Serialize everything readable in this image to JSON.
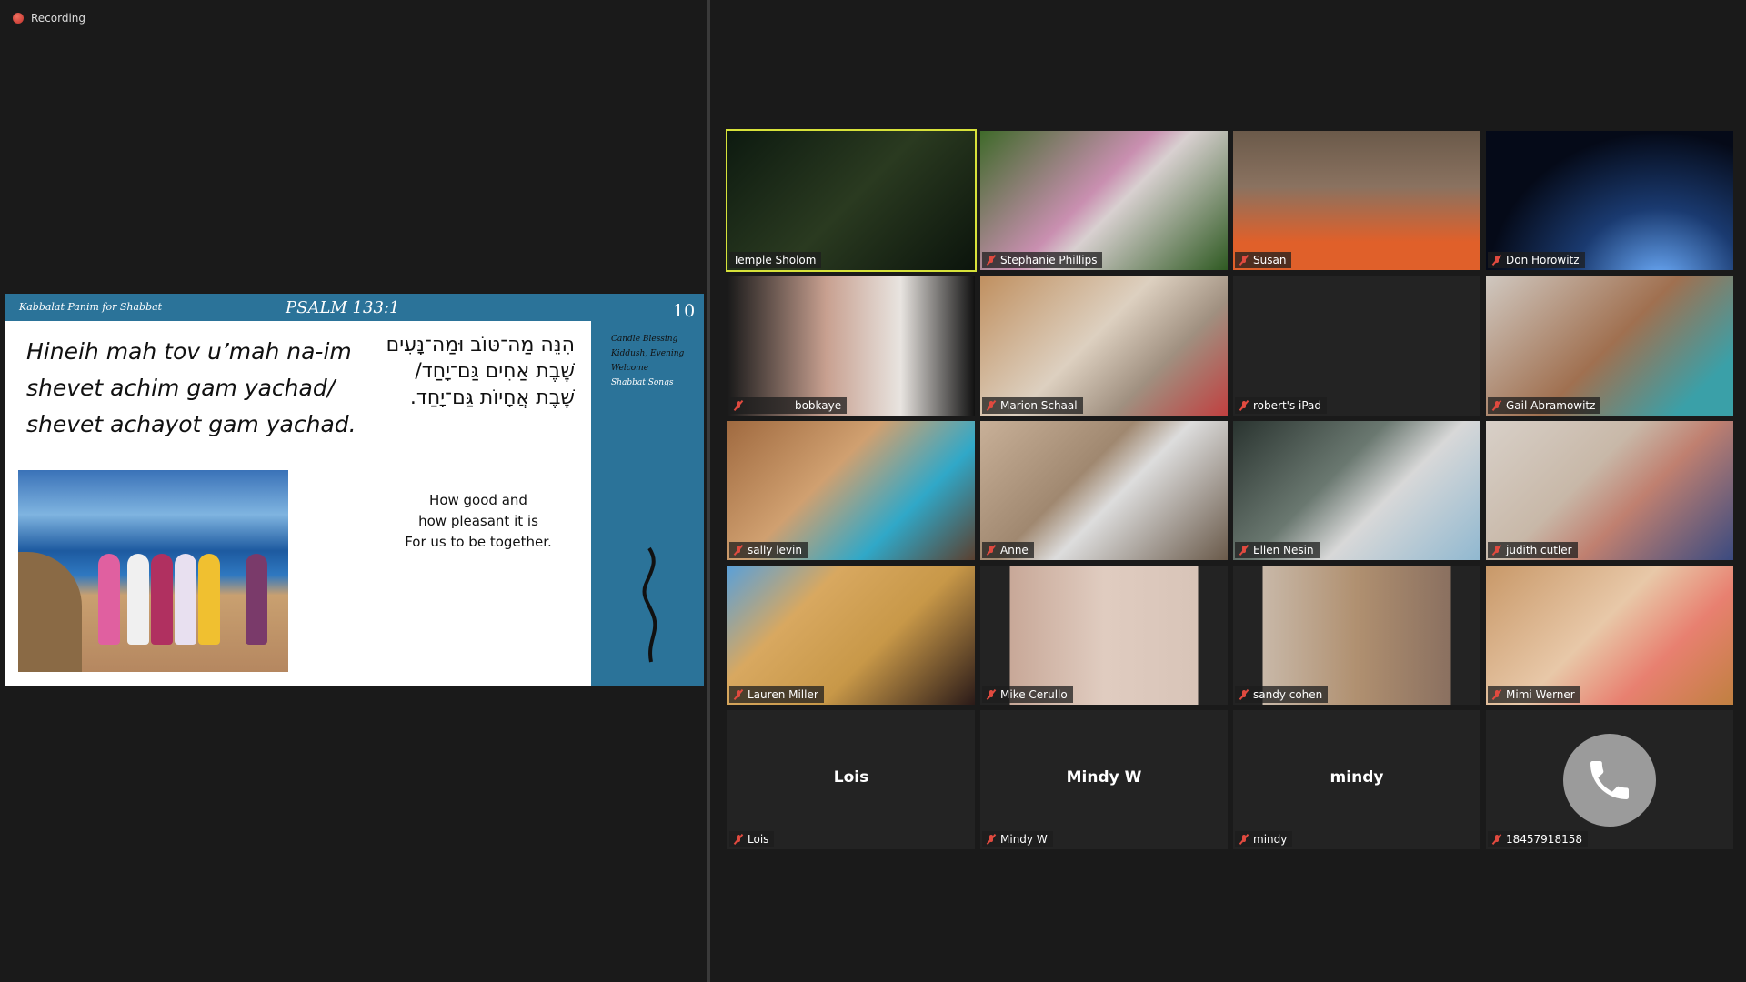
{
  "recording": {
    "label": "Recording",
    "color": "#d9443a"
  },
  "slide": {
    "header_left": "Kabbalat Panim for Shabbat",
    "title": "PSALM 133:1",
    "page_number": "10",
    "transliteration": [
      "Hineih mah tov u’mah na-im",
      "shevet achim gam yachad/",
      "shevet achayot gam yachad."
    ],
    "hebrew": [
      "הִנֵּה מַה־טּוֹב וּמַה־נָּעִים",
      "שֶׁבֶת אַחִים גַּם־יָחַד/",
      "שֶׁבֶת אֲחָיוֹת גַּם־יָחַד."
    ],
    "english": [
      "How good and",
      "how pleasant it is",
      "For us to be together."
    ],
    "nav": [
      "Candle Blessing",
      "Kiddush, Evening",
      "Welcome",
      "Shabbat Songs"
    ],
    "accent": "#2b7399"
  },
  "participants": [
    {
      "name": "Temple Sholom",
      "active": true,
      "muted": false,
      "bg": "linear-gradient(135deg,#0d1a10,#2a3a20 50%,#0b140c)"
    },
    {
      "name": "Stephanie Phillips",
      "muted": true,
      "bg": "linear-gradient(135deg,#3f6a2a,#c98fb0 45%,#d8d0d0 55%,#2f5a22)"
    },
    {
      "name": "Susan",
      "muted": true,
      "bg": "linear-gradient(180deg,#6b5a4a,#8a7260 40%,#e0602a 80%)"
    },
    {
      "name": "Don Horowitz",
      "muted": true,
      "bg": "radial-gradient(ellipse at 70% 110%,#6fb0ff 0%,#1a3a70 35%,#050a18 70%)"
    },
    {
      "name": "------------bobkaye",
      "muted": true,
      "bg": "linear-gradient(90deg,#1a1a1a,#c8a090 40%,#e8e4e0 70%,#111)"
    },
    {
      "name": "Marion Schaal",
      "muted": true,
      "bg": "linear-gradient(135deg,#c09060,#ddd0c0 45%,#a09080 70%,#c04040)"
    },
    {
      "name": "robert's iPad",
      "muted": true,
      "bg": "#232323"
    },
    {
      "name": "Gail Abramowitz",
      "muted": true,
      "bg": "linear-gradient(135deg,#d0c8c0,#a07050 50%,#3aa0a8 85%)"
    },
    {
      "name": "sally levin",
      "muted": true,
      "bg": "linear-gradient(135deg,#a06a40,#d0a070 40%,#30a8c8 70%,#5a4030)"
    },
    {
      "name": "Anne",
      "muted": true,
      "bg": "linear-gradient(135deg,#c8b098,#a08870 40%,#ddd 55%,#6a5a4a)"
    },
    {
      "name": "Ellen  Nesin",
      "muted": true,
      "bg": "linear-gradient(135deg,#2a3430,#6a7870 40%,#d8d8d8 60%,#90b8d0)"
    },
    {
      "name": "judith cutler",
      "muted": true,
      "bg": "linear-gradient(135deg,#d8d0c8,#c8b8a8 40%,#c08070 60%,#3a4a80)"
    },
    {
      "name": "Lauren Miller",
      "muted": true,
      "bg": "linear-gradient(135deg,#5aa0d8,#d8a860 30%,#c89848 60%,#2a1a18)"
    },
    {
      "name": "Mike Cerullo",
      "muted": true,
      "bg": "linear-gradient(90deg,#232323 12%,#c8a898 12%,#e0ccc0 50%,#d8c4b8 88%,#232323 88%)"
    },
    {
      "name": "sandy cohen",
      "muted": true,
      "bg": "linear-gradient(90deg,#232323 12%,#c8b8a8 12%,#b09070 50%,#8a7060 88%,#232323 88%)"
    },
    {
      "name": "Mimi Werner",
      "muted": true,
      "bg": "linear-gradient(135deg,#c89868,#e8c8a8 45%,#e88070 70%,#c08040)"
    },
    {
      "name": "Lois",
      "muted": true,
      "display": "Lois",
      "bg": "#232323"
    },
    {
      "name": "Mindy W",
      "muted": true,
      "display": "Mindy W",
      "bg": "#232323"
    },
    {
      "name": "mindy",
      "muted": true,
      "display": "mindy",
      "bg": "#232323"
    },
    {
      "name": "18457918158",
      "muted": true,
      "phone": true,
      "bg": "#232323"
    }
  ]
}
